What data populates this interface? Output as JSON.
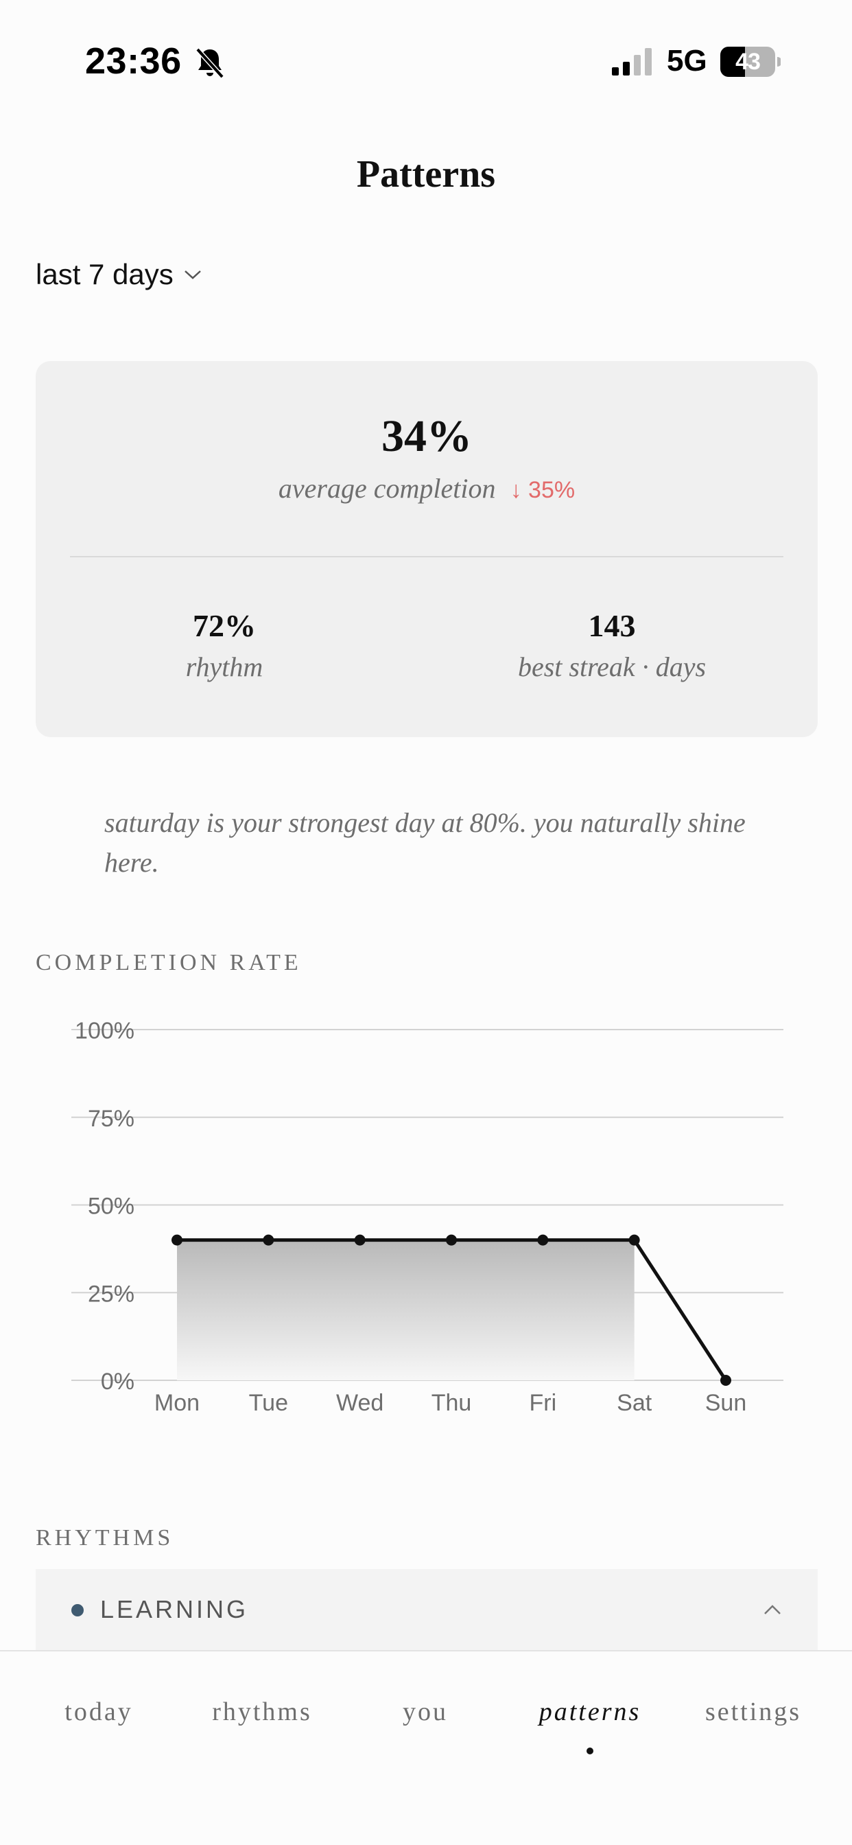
{
  "status_bar": {
    "time": "23:36",
    "network": "5G",
    "battery": "43"
  },
  "header": {
    "title": "Patterns"
  },
  "range_select": {
    "label": "last 7 days"
  },
  "summary": {
    "average_value": "34%",
    "average_label": "average completion",
    "delta": "↓ 35%",
    "rhythm_value": "72%",
    "rhythm_label": "rhythm",
    "streak_value": "143",
    "streak_label": "best streak · days"
  },
  "insight": "saturday is your strongest day at 80%. you naturally shine here.",
  "sections": {
    "completion_rate": "COMPLETION RATE",
    "rhythms": "RHYTHMS"
  },
  "chart_data": {
    "type": "area",
    "categories": [
      "Mon",
      "Tue",
      "Wed",
      "Thu",
      "Fri",
      "Sat",
      "Sun"
    ],
    "values": [
      40,
      40,
      40,
      40,
      40,
      40,
      0
    ],
    "y_ticks": [
      "0%",
      "25%",
      "50%",
      "75%",
      "100%"
    ],
    "ylim": [
      0,
      100
    ],
    "grid": true,
    "line_color": "#111111",
    "fill": "gradient-gray"
  },
  "accordion": {
    "label": "LEARNING",
    "dot_color": "#3f5a70",
    "expanded": true
  },
  "tabs": [
    {
      "label": "today",
      "active": false
    },
    {
      "label": "rhythms",
      "active": false
    },
    {
      "label": "you",
      "active": false
    },
    {
      "label": "patterns",
      "active": true
    },
    {
      "label": "settings",
      "active": false
    }
  ]
}
